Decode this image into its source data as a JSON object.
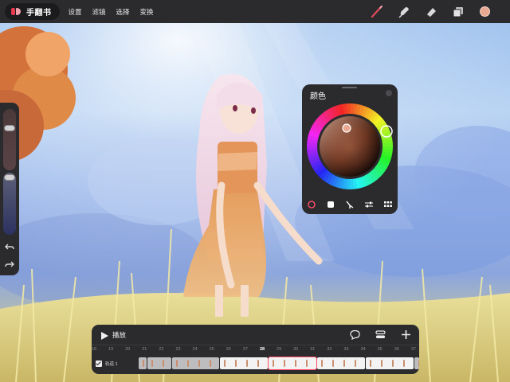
{
  "app": {
    "name": "手翻书"
  },
  "menu": {
    "items": [
      "设置",
      "滤镜",
      "选择",
      "变换"
    ]
  },
  "tools": [
    {
      "name": "brush-icon",
      "color": "#e04a5a"
    },
    {
      "name": "smudge-icon",
      "color": "#d9d9dc"
    },
    {
      "name": "eraser-icon",
      "color": "#d9d9dc"
    },
    {
      "name": "layers-icon",
      "color": "#d9d9dc"
    }
  ],
  "current_color": "#e8a891",
  "color_panel": {
    "title": "颜色",
    "selected_hue": "#f07030",
    "tabs": [
      "disc-icon",
      "classic-icon",
      "harmony-icon",
      "sliders-icon",
      "palettes-icon"
    ]
  },
  "timeline": {
    "play_label": "播放",
    "frame_numbers": [
      "18",
      "19",
      "20",
      "21",
      "22",
      "23",
      "24",
      "25",
      "26",
      "27",
      "28",
      "29",
      "30",
      "31",
      "32",
      "33",
      "34",
      "35",
      "36",
      "37"
    ],
    "current_frame": "28",
    "track_label": "轨道 1"
  }
}
